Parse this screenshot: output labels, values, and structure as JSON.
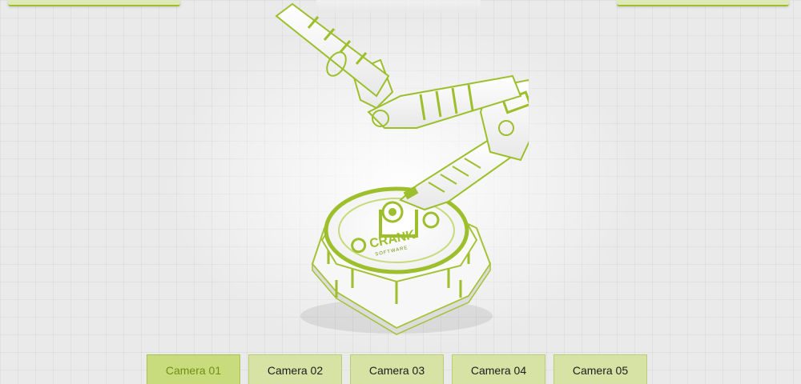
{
  "cameras": {
    "active_index": 0,
    "items": [
      {
        "label": "Camera 01"
      },
      {
        "label": "Camera 02"
      },
      {
        "label": "Camera 03"
      },
      {
        "label": "Camera 04"
      },
      {
        "label": "Camera 05"
      }
    ]
  },
  "robot": {
    "logo_text": "CRANK",
    "logo_subtext": "SOFTWARE"
  },
  "colors": {
    "accent": "#9cbf2b",
    "button_bg": "#d6e3a5",
    "button_active_text": "#6f8f12",
    "background": "#eaeaea"
  }
}
